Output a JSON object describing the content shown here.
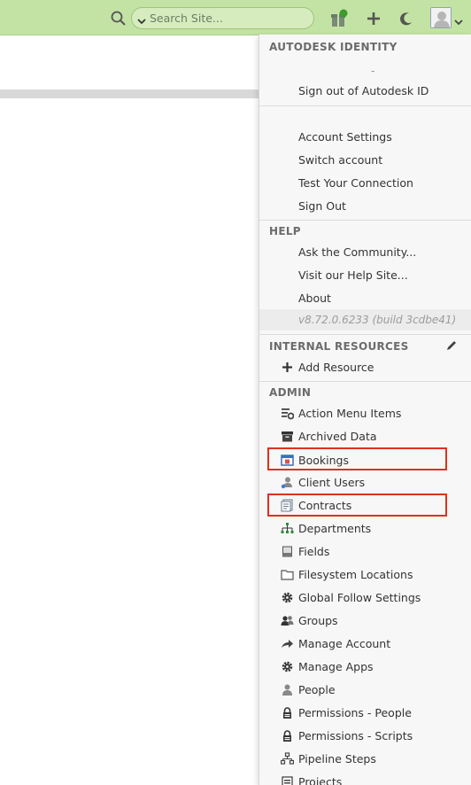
{
  "topbar": {
    "search_placeholder": "Search Site...",
    "icons": [
      "search-icon",
      "chevron-down-icon",
      "gift-icon",
      "plus-icon",
      "moon-icon",
      "avatar-icon",
      "chevron-down-icon"
    ],
    "notification_dot_color": "#3c9a2e"
  },
  "menu": {
    "identity": {
      "header": "AUTODESK IDENTITY",
      "user_placeholder": "-",
      "sign_out_autodesk": "Sign out of Autodesk ID"
    },
    "account": {
      "items": [
        "Account Settings",
        "Switch account",
        "Test Your Connection",
        "Sign Out"
      ]
    },
    "help": {
      "header": "HELP",
      "items": [
        "Ask the Community...",
        "Visit our Help Site...",
        "About"
      ],
      "version": "v8.72.0.6233 (build 3cdbe41)"
    },
    "internal": {
      "header": "INTERNAL RESOURCES",
      "add_resource": "Add Resource"
    },
    "admin": {
      "header": "ADMIN",
      "items": [
        {
          "label": "Action Menu Items",
          "icon": "action-menu-icon"
        },
        {
          "label": "Archived Data",
          "icon": "archive-box-icon"
        },
        {
          "label": "Bookings",
          "icon": "bookings-icon"
        },
        {
          "label": "Client Users",
          "icon": "client-user-icon"
        },
        {
          "label": "Contracts",
          "icon": "contracts-icon"
        },
        {
          "label": "Departments",
          "icon": "org-chart-icon"
        },
        {
          "label": "Fields",
          "icon": "field-icon"
        },
        {
          "label": "Filesystem Locations",
          "icon": "folder-icon"
        },
        {
          "label": "Global Follow Settings",
          "icon": "gear-icon"
        },
        {
          "label": "Groups",
          "icon": "group-icon"
        },
        {
          "label": "Manage Account",
          "icon": "share-arrow-icon"
        },
        {
          "label": "Manage Apps",
          "icon": "gear-icon"
        },
        {
          "label": "People",
          "icon": "person-icon"
        },
        {
          "label": "Permissions - People",
          "icon": "lock-icon"
        },
        {
          "label": "Permissions - Scripts",
          "icon": "lock-icon"
        },
        {
          "label": "Pipeline Steps",
          "icon": "pipeline-icon"
        },
        {
          "label": "Projects",
          "icon": "projects-icon"
        }
      ],
      "highlighted": [
        "Bookings",
        "Contracts"
      ]
    }
  },
  "colors": {
    "topbar_bg": "#c3e3a4",
    "highlight": "#e03020",
    "menu_bg": "#f7f7f7"
  }
}
